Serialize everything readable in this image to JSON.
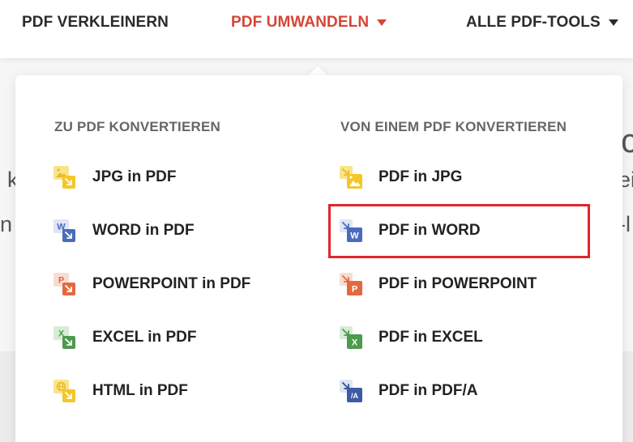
{
  "nav": {
    "items": [
      {
        "label": "PDF VERKLEINERN",
        "active": false
      },
      {
        "label": "PDF UMWANDELN",
        "active": true
      },
      {
        "label": "ALLE PDF-TOOLS",
        "active": false
      }
    ]
  },
  "background_fragments": [
    "k",
    "n",
    "c",
    "ei",
    "-l"
  ],
  "dropdown": {
    "left_heading": "ZU PDF KONVERTIEREN",
    "right_heading": "VON EINEM PDF KONVERTIEREN",
    "left_items": [
      {
        "label": "JPG in PDF",
        "icon": "jpg-to-pdf-icon"
      },
      {
        "label": "WORD in PDF",
        "icon": "word-to-pdf-icon"
      },
      {
        "label": "POWERPOINT in PDF",
        "icon": "powerpoint-to-pdf-icon"
      },
      {
        "label": "EXCEL in PDF",
        "icon": "excel-to-pdf-icon"
      },
      {
        "label": "HTML in PDF",
        "icon": "html-to-pdf-icon"
      }
    ],
    "right_items": [
      {
        "label": "PDF in JPG",
        "icon": "pdf-to-jpg-icon"
      },
      {
        "label": "PDF in WORD",
        "icon": "pdf-to-word-icon"
      },
      {
        "label": "PDF in POWERPOINT",
        "icon": "pdf-to-powerpoint-icon"
      },
      {
        "label": "PDF in EXCEL",
        "icon": "pdf-to-excel-icon"
      },
      {
        "label": "PDF in PDF/A",
        "icon": "pdf-to-pdfa-icon"
      }
    ]
  },
  "icon_letters": {
    "word": "W",
    "powerpoint": "P",
    "excel": "X",
    "pdfa": "/A"
  },
  "colors": {
    "accent": "#d64535",
    "highlight": "#e0262b",
    "jpg": "#f5d23f",
    "word": "#4a6bbd",
    "powerpoint": "#e3683f",
    "excel": "#4c9b4e",
    "pdf": "#f4c62a"
  }
}
